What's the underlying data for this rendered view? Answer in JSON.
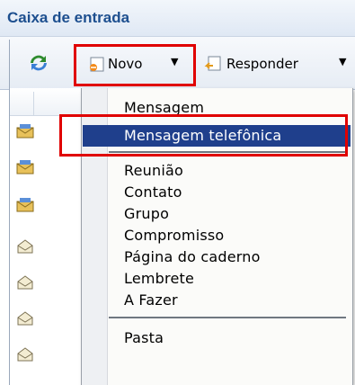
{
  "window": {
    "title": "Caixa de entrada"
  },
  "toolbar": {
    "novo_label": "Novo",
    "responder_label": "Responder"
  },
  "menu": {
    "items": [
      "Mensagem",
      "Mensagem telefônica",
      "Reunião",
      "Contato",
      "Grupo",
      "Compromisso",
      "Página do caderno",
      "Lembrete",
      "A Fazer",
      "Pasta"
    ],
    "selected": "Mensagem telefônica"
  },
  "icons": {
    "refresh": "refresh-icon",
    "new": "new-item-icon",
    "reply": "reply-icon",
    "mail_read": "open-envelope-icon",
    "mail_unread": "closed-envelope-icon"
  },
  "colors": {
    "title": "#1d4f8f",
    "selection": "#1f3f8c",
    "highlight": "#e00000"
  }
}
